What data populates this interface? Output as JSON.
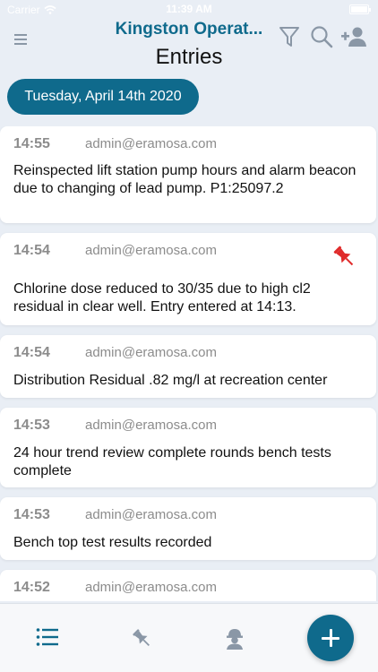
{
  "status_bar": {
    "carrier": "Carrier",
    "time": "11:39 AM"
  },
  "header": {
    "app_title": "Kingston Operat...",
    "page_title": "Entries",
    "icons": [
      "menu-icon",
      "filter-icon",
      "search-icon",
      "add-user-icon"
    ]
  },
  "date_pill": {
    "label": "Tuesday, April 14th 2020"
  },
  "entries": [
    {
      "time": "14:55",
      "author": "admin@eramosa.com",
      "text": "Reinspected lift station pump hours and alarm beacon due to changing of lead pump. P1:25097.2",
      "pinned": false
    },
    {
      "time": "14:54",
      "author": "admin@eramosa.com",
      "text": "Chlorine dose reduced to 30/35 due to high cl2 residual in clear well. Entry entered at 14:13.",
      "pinned": true
    },
    {
      "time": "14:54",
      "author": "admin@eramosa.com",
      "text": "Distribution Residual .82 mg/l at recreation center",
      "pinned": false
    },
    {
      "time": "14:53",
      "author": "admin@eramosa.com",
      "text": "24 hour trend review complete rounds bench tests complete",
      "pinned": false
    },
    {
      "time": "14:53",
      "author": "admin@eramosa.com",
      "text": "Bench top test results recorded",
      "pinned": false
    },
    {
      "time": "14:52",
      "author": "admin@eramosa.com",
      "text": "",
      "pinned": false
    }
  ],
  "tab_bar": {
    "tabs": [
      "list-icon",
      "pin-icon",
      "worker-icon"
    ],
    "active": "list-icon",
    "fab_icon": "plus-icon"
  },
  "colors": {
    "brand": "#0f6a8c",
    "pin": "#e02b2b",
    "background": "#e9eef5"
  }
}
